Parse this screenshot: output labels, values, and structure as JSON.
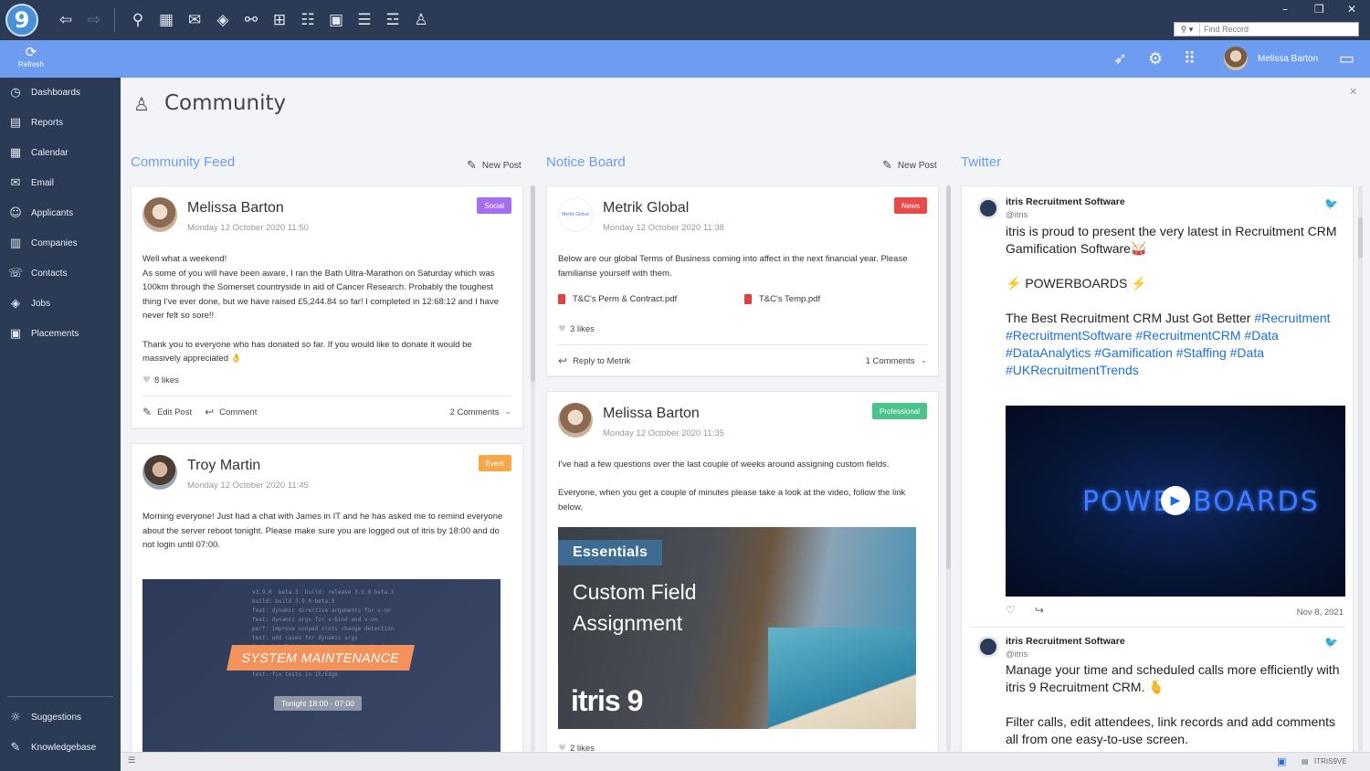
{
  "toolbar": {
    "logo": "9",
    "find_placeholder": "Find Record"
  },
  "ribbon": {
    "refresh_label": "Refresh",
    "user_name": "Melissa Barton"
  },
  "sidebar": {
    "items": [
      {
        "label": "Dashboards",
        "icon": "dashboard-icon"
      },
      {
        "label": "Reports",
        "icon": "reports-icon"
      },
      {
        "label": "Calendar",
        "icon": "calendar-icon"
      },
      {
        "label": "Email",
        "icon": "email-icon"
      },
      {
        "label": "Applicants",
        "icon": "applicants-icon"
      },
      {
        "label": "Companies",
        "icon": "companies-icon"
      },
      {
        "label": "Contacts",
        "icon": "contacts-icon"
      },
      {
        "label": "Jobs",
        "icon": "jobs-icon"
      },
      {
        "label": "Placements",
        "icon": "placements-icon"
      }
    ],
    "bottom": [
      {
        "label": "Suggestions",
        "icon": "lightbulb-icon"
      },
      {
        "label": "Knowledgebase",
        "icon": "knowledgebase-icon"
      }
    ]
  },
  "page": {
    "title": "Community"
  },
  "feed": {
    "heading": "Community Feed",
    "new_post": "New Post",
    "posts": [
      {
        "author": "Melissa Barton",
        "date": "Monday 12 October 2020 11:50",
        "badge": "Social",
        "badge_color": "#a86ef0",
        "body": [
          "Well what a weekend!",
          "As some of you will have been aware, I ran the Bath Ultra-Marathon on Saturday which was 100km through the Somerset countryside in aid of Cancer Research. Probably the toughest thing I've ever done, but we have raised £5,244.84 so far! I completed in 12:68:12 and I have never felt so sore!!",
          "Thank you to everyone who has donated so far. If you would like to donate it would be massively appreciated 👌"
        ],
        "likes": "8 likes",
        "edit_label": "Edit Post",
        "comment_label": "Comment",
        "comments": "2 Comments"
      },
      {
        "author": "Troy Martin",
        "date": "Monday 12 October 2020 11:45",
        "badge": "Event",
        "badge_color": "#f5a84a",
        "body": "Morning everyone! Just had a chat with James in IT and he has asked me to remind everyone about the server reboot tonight. Please make sure you are logged out of itris by 18:00 and do not login until 07:00.",
        "image_banner": "SYSTEM MAINTENANCE",
        "image_time": "Tonight 18:00 - 07:00"
      }
    ]
  },
  "notice": {
    "heading": "Notice Board",
    "new_post": "New Post",
    "posts": [
      {
        "author": "Metrik Global",
        "logo_text": "Metrik Global",
        "date": "Monday 12 October 2020 11:38",
        "badge": "News",
        "badge_color": "#e84a4a",
        "body": "Below are our global Terms of Business coming into affect in the next financial year. Please familiarise yourself with them.",
        "files": [
          "T&C's Perm & Contract.pdf",
          "T&C's Temp.pdf"
        ],
        "likes": "3 likes",
        "reply_label": "Reply to Metrik",
        "comments": "1 Comments"
      },
      {
        "author": "Melissa Barton",
        "date": "Monday 12 October 2020 11:35",
        "badge": "Professional",
        "badge_color": "#4cc38a",
        "body": [
          "I've had a few questions over the last couple of weeks around assigning custom fields.",
          "Everyone, when you get a couple of minutes please take a look at the video, follow the link below."
        ],
        "video_tag": "Essentials",
        "video_title_1": "Custom Field",
        "video_title_2": "Assignment",
        "video_brand": "itris 9",
        "likes": "2 likes"
      }
    ]
  },
  "twitter": {
    "heading": "Twitter",
    "tweets": [
      {
        "name": "itris Recruitment Software",
        "handle": "@itris",
        "text_1": "itris is proud to present the very latest in Recruitment CRM Gamification Software🥁",
        "text_2": "⚡ POWERBOARDS ⚡",
        "text_3": "The Best Recruitment CRM Just Got Better",
        "hashtags": " #Recruitment #RecruitmentSoftware #RecruitmentCRM #Data #DataAnalytics #Gamification #Staffing #Data #UKRecruitmentTrends",
        "video_text": "POWERBOARDS",
        "date": "Nov 8, 2021"
      },
      {
        "name": "itris Recruitment Software",
        "handle": "@itris",
        "text_1": "Manage your time and scheduled calls more efficiently with itris 9 Recruitment CRM. 🫰",
        "text_2": "Filter calls, edit attendees, link records and add comments all from one easy-to-use screen."
      }
    ]
  },
  "statusbar": {
    "server": "ITRIS9VE"
  }
}
